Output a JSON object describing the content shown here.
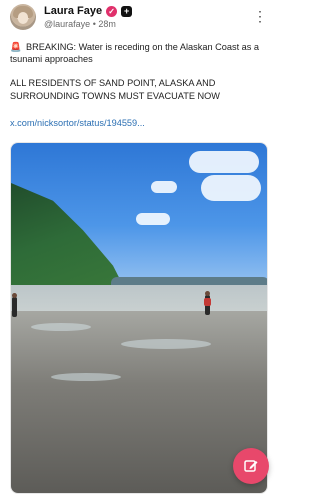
{
  "author": {
    "name": "Laura Faye",
    "handle": "@laurafaye",
    "separator": "•",
    "time": "28m",
    "verified_icon": "checkmark-icon",
    "badge_icon": "plus-badge-icon"
  },
  "post": {
    "paragraphs": [
      "BREAKING: Water is receding on the Alaskan Coast as a tsunami approaches",
      "ALL RESIDENTS OF SAND POINT, ALASKA AND SURROUNDING TOWNS MUST EVACUATE NOW"
    ],
    "siren": "🚨",
    "link": "x.com/nicksortor/status/194559..."
  },
  "media": {
    "description_icon": "video-thumbnail"
  },
  "fab": {
    "icon": "compose-icon"
  },
  "colors": {
    "accent": "#e8486b",
    "link": "#2b6fb3",
    "verified": "#e0306b"
  }
}
